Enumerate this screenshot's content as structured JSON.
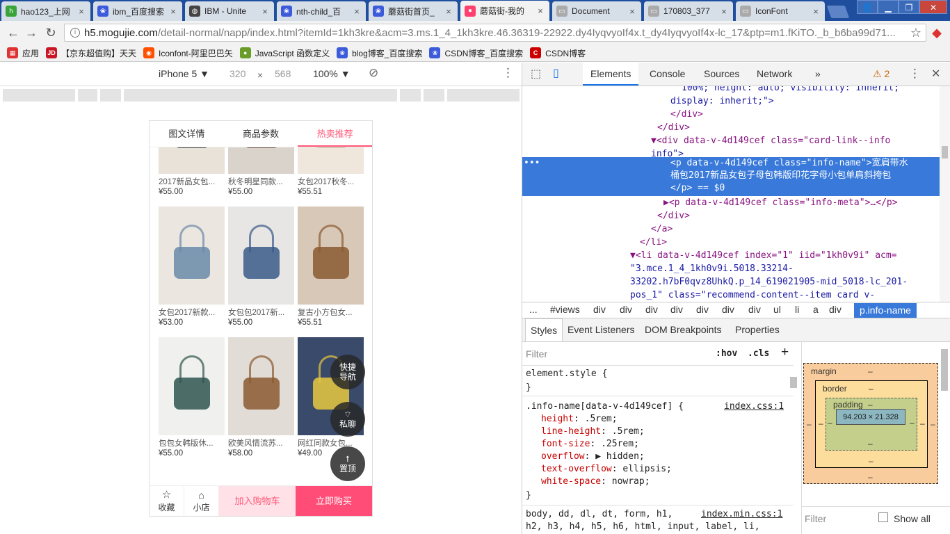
{
  "browser": {
    "tabs": [
      {
        "title": "hao123_上网",
        "fav": "hao-icon",
        "color": "#3aa43a",
        "glyph": "h"
      },
      {
        "title": "ibm_百度搜索",
        "fav": "baidu-paw-icon",
        "color": "#3b5bdb",
        "glyph": "❀"
      },
      {
        "title": "IBM - Unite",
        "fav": "globe-icon",
        "color": "#444",
        "glyph": "◍"
      },
      {
        "title": "nth-child_百",
        "fav": "baidu-paw-icon",
        "color": "#3b5bdb",
        "glyph": "❀"
      },
      {
        "title": "蘑菇街首页_",
        "fav": "baidu-paw-icon",
        "color": "#3b5bdb",
        "glyph": "❀"
      },
      {
        "title": "蘑菇街-我的",
        "fav": "mogujie-icon",
        "color": "#ff3f6c",
        "glyph": "●"
      },
      {
        "title": "Document",
        "fav": "page-icon",
        "color": "#aaa",
        "glyph": "▭"
      },
      {
        "title": "170803_377",
        "fav": "page-icon",
        "color": "#aaa",
        "glyph": "▭"
      },
      {
        "title": "IconFont",
        "fav": "page-icon",
        "color": "#aaa",
        "glyph": "▭"
      }
    ],
    "url_host": "h5.mogujie.com",
    "url_path": "/detail-normal/napp/index.html?itemId=1kh3kre&acm=3.ms.1_4_1kh3kre.46.36319-22922.dy4IyqvyoIf4x.t_dy4IyqvyoIf4x-lc_17&ptp=m1.fKiTO._b_b6ba99d71...",
    "bookmarks": [
      {
        "label": "应用",
        "icon": "apps-icon",
        "color": "#d33",
        "glyph": "▦"
      },
      {
        "label": "【京东超值购】天天",
        "icon": "jd-icon",
        "color": "#c81623",
        "glyph": "JD"
      },
      {
        "label": "Iconfont-阿里巴巴矢",
        "icon": "iconfont-icon",
        "color": "#ff5000",
        "glyph": "◉"
      },
      {
        "label": "JavaScript 函数定义",
        "icon": "runoob-icon",
        "color": "#6a9c2a",
        "glyph": "●"
      },
      {
        "label": "blog博客_百度搜索",
        "icon": "baidu-paw-icon",
        "color": "#3b5bdb",
        "glyph": "❀"
      },
      {
        "label": "CSDN博客_百度搜索",
        "icon": "baidu-paw-icon",
        "color": "#3b5bdb",
        "glyph": "❀"
      },
      {
        "label": "CSDN博客",
        "icon": "csdn-icon",
        "color": "#c00",
        "glyph": "C"
      }
    ]
  },
  "device": {
    "name": "iPhone 5 ▼",
    "width": "320",
    "x": "×",
    "height": "568",
    "zoom": "100% ▼"
  },
  "phone": {
    "tabs": [
      "图文详情",
      "商品参数",
      "热卖推荐"
    ],
    "products": [
      {
        "name": "2017新品女包...",
        "price": "¥55.00",
        "bg": "#e8e2d8",
        "accent": "#2a2a2a"
      },
      {
        "name": "秋冬明星同款...",
        "price": "¥55.00",
        "bg": "#d9d3cc",
        "accent": "#5a3b2a"
      },
      {
        "name": "女包2017秋冬...",
        "price": "¥55.51",
        "bg": "#efe6dc",
        "accent": "#c7a78a"
      },
      {
        "name": "女包2017新款...",
        "price": "¥53.00",
        "bg": "#ece6e0",
        "accent": "#6a8aa8"
      },
      {
        "name": "女包包2017新...",
        "price": "¥55.00",
        "bg": "#e8e6e4",
        "accent": "#3a5a8a"
      },
      {
        "name": "复古小方包女...",
        "price": "¥55.51",
        "bg": "#d8c8b8",
        "accent": "#8a5a30"
      },
      {
        "name": "包包女韩版休...",
        "price": "¥55.00",
        "bg": "#f0f0ee",
        "accent": "#2f5550"
      },
      {
        "name": "欧美风情流苏...",
        "price": "¥58.00",
        "bg": "#e2dcd6",
        "accent": "#8a5a30"
      },
      {
        "name": "网红同款女包...",
        "price": "¥49.00",
        "bg": "#3a4a6a",
        "accent": "#e8c840"
      }
    ],
    "fab": {
      "nav": [
        "快捷",
        "导航"
      ],
      "chat": "私聊",
      "top": "置顶"
    },
    "bottom": {
      "fav": "收藏",
      "shop": "小店",
      "cart": "加入购物车",
      "buy": "立即购买"
    }
  },
  "devtools": {
    "tabs": [
      "Elements",
      "Console",
      "Sources",
      "Network",
      "»"
    ],
    "warn": "⚠ 2",
    "dom": [
      {
        "t": "100%; height: auto; visibility: inherit;",
        "k": "attr"
      },
      {
        "t": "display: inherit;\">",
        "k": "attr"
      },
      {
        "t": "</div>",
        "k": "tag"
      },
      {
        "t": "</div>",
        "k": "tag"
      },
      {
        "t": "▼<div data-v-4d149cef class=\"card-link--info",
        "k": "mixed",
        "a": "data-v-4d149cef",
        "c": "\"card-link--info"
      },
      {
        "t": "info\">",
        "k": "av"
      },
      {
        "t": "<p data-v-4d149cef class=\"info-name\">宽肩带水",
        "k": "sel"
      },
      {
        "t": "桶包2017新品女包子母包韩版印花字母小包单肩斜挎包",
        "k": "selt"
      },
      {
        "t": "</p> == $0",
        "k": "sel2"
      },
      {
        "t": "▶<p data-v-4d149cef class=\"info-meta\">…</p>",
        "k": "tag"
      },
      {
        "t": "</div>",
        "k": "tag"
      },
      {
        "t": "</a>",
        "k": "tag"
      },
      {
        "t": "</li>",
        "k": "tag"
      },
      {
        "t": "▼<li data-v-4d149cef index=\"1\" iid=\"1kh0v9i\" acm=",
        "k": "tag"
      },
      {
        "t": "\"3.mce.1_4_1kh0v9i.5018.33214-",
        "k": "av"
      },
      {
        "t": "33202.h7bF0qvz8UhkQ.p_14_619021905-mid_5018-lc_201-",
        "k": "av"
      },
      {
        "t": "pos_1\" class=\"recommend-content--item card v-",
        "k": "av"
      }
    ],
    "crumbs": [
      "...",
      "#views",
      "div",
      "div",
      "div",
      "div",
      "div",
      "div",
      "div",
      "ul",
      "li",
      "a",
      "div",
      "p.info-name"
    ],
    "subtabs": [
      "Styles",
      "Event Listeners",
      "DOM Breakpoints",
      "Properties"
    ],
    "filter": "Filter",
    "hov": ":hov",
    "cls": ".cls",
    "plus": "+",
    "styles": {
      "el_style": "element.style {",
      "close": "}",
      "selector": ".info-name[data-v-4d149cef] {",
      "source": "index.css:1",
      "props": [
        {
          "name": "height",
          "value": ".5rem;"
        },
        {
          "name": "line-height",
          "value": ".5rem;"
        },
        {
          "name": "font-size",
          "value": ".25rem;"
        },
        {
          "name": "overflow",
          "value": "▶ hidden;"
        },
        {
          "name": "text-overflow",
          "value": "ellipsis;"
        },
        {
          "name": "white-space",
          "value": "nowrap;"
        }
      ],
      "next_sel": "body, dd, dl, dt, form, h1,",
      "next_src": "index.min.css:1",
      "next_sel2": "h2, h3, h4, h5, h6, html, input, label, li,"
    },
    "box": {
      "margin": "margin",
      "border": "border",
      "padding": "padding",
      "dash": "–",
      "content": "94.203 × 21.328"
    },
    "bottom_filter": "Filter",
    "show_all": "Show all"
  }
}
